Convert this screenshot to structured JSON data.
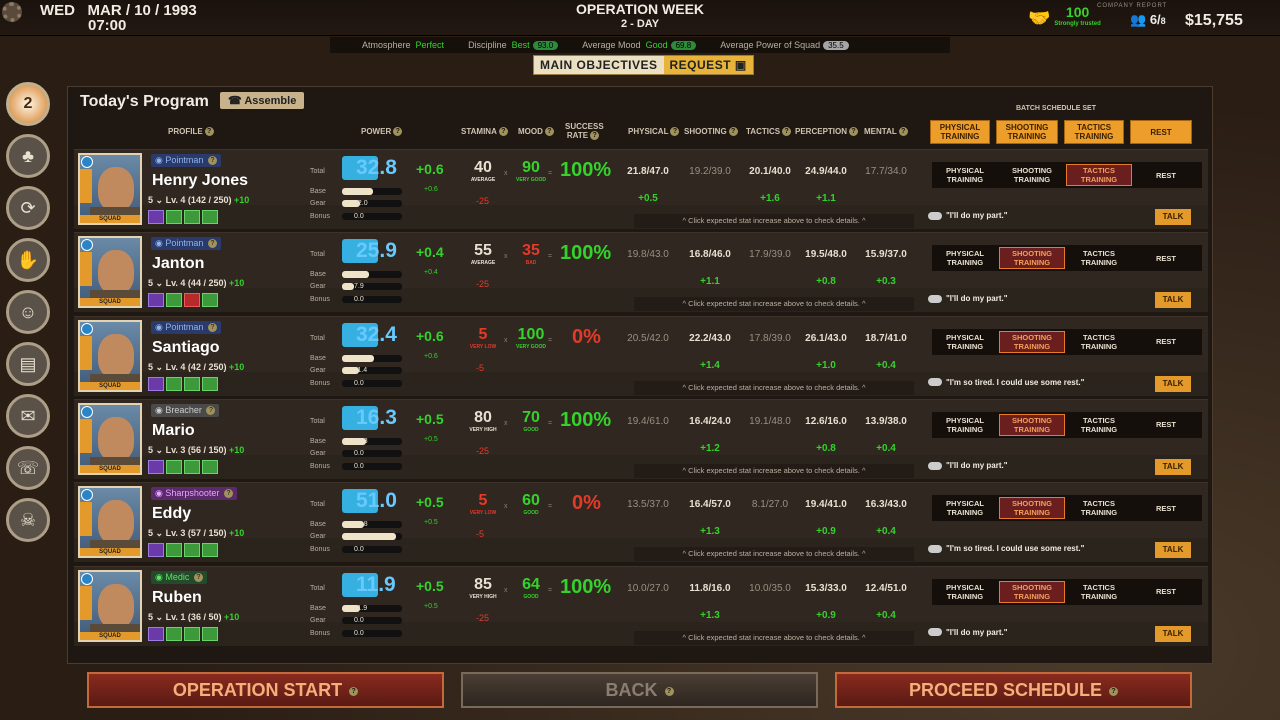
{
  "top": {
    "day": "WED",
    "date": "MAR / 10 / 1993",
    "time": "07:00",
    "op_title": "OPERATION WEEK",
    "op_day": "2 - DAY",
    "trust_value": "100",
    "trust_label": "Strongly trusted",
    "company_report": "COMPANY REPORT",
    "human": "6",
    "human_max": "8",
    "human_label": "HUMAN RESOURCE",
    "money": "$15,755"
  },
  "stats": {
    "atm_label": "Atmosphere",
    "atm_value": "Perfect",
    "disc_label": "Discipline",
    "disc_value": "Best",
    "disc_num": "93.0",
    "mood_label": "Average Mood",
    "mood_value": "Good",
    "mood_num": "69.8",
    "power_label": "Average Power of Squad",
    "power_num": "35.5"
  },
  "tabs": {
    "main": "MAIN OBJECTIVES",
    "request": "REQUEST"
  },
  "side": {
    "badge": "2"
  },
  "panel": {
    "title": "Today's Program",
    "assemble": "Assemble"
  },
  "headers": {
    "profile": "PROFILE",
    "power": "POWER",
    "stamina": "STAMINA",
    "mood": "MOOD",
    "success": "SUCCESS RATE",
    "physical": "PHYSICAL",
    "shooting": "SHOOTING",
    "tactics": "TACTICS",
    "perception": "PERCEPTION",
    "mental": "MENTAL",
    "batch": "BATCH SCHEDULE SET"
  },
  "batch": {
    "phys": "PHYSICAL TRAINING",
    "shoot": "SHOOTING TRAINING",
    "tac": "TACTICS TRAINING",
    "rest": "REST"
  },
  "labels": {
    "total": "Total",
    "base": "Base",
    "gear": "Gear",
    "bonus": "Bonus",
    "squad": "SQUAD",
    "x": "x",
    "eq": "=",
    "hint": "^ Click expected stat increase above to check details. ^",
    "talk": "TALK",
    "tphys": "PHYSICAL TRAINING",
    "tshoot": "SHOOTING TRAINING",
    "ttac": "TACTICS TRAINING",
    "trest": "REST"
  },
  "mercs": [
    {
      "role": "Pointman",
      "name": "Henry Jones",
      "cnt": "5",
      "lvl": "Lv. 4 (142 / 250)",
      "xp": "+10",
      "total": "32.8",
      "inc": "+0.6",
      "base": "20.7",
      "gear": "12.0",
      "bonus": "0.0",
      "binc": "+0.6",
      "stam": "40",
      "stam_lbl": "AVERAGE",
      "stam_minus": "-25",
      "mood": "90",
      "mood_lbl": "VERY GOOD",
      "succ": "100%",
      "phys": "21.8/47.0",
      "shoot": "19.2/39.0",
      "tac": "20.1/40.0",
      "perc": "24.9/44.0",
      "ment": "17.7/34.0",
      "i_phys": "+0.5",
      "i_shoot": "",
      "i_tac": "+1.6",
      "i_perc": "+1.1",
      "i_ment": "",
      "quote": "\"I'll do my part.\"",
      "sel": "tac"
    },
    {
      "role": "Pointman",
      "name": "Janton",
      "cnt": "5",
      "lvl": "Lv. 4 (44 / 250)",
      "xp": "+10",
      "total": "25.9",
      "inc": "+0.4",
      "base": "18.0",
      "gear": "7.9",
      "bonus": "0.0",
      "binc": "+0.4",
      "stam": "55",
      "stam_lbl": "AVERAGE",
      "stam_minus": "-25",
      "mood": "35",
      "mood_lbl": "BAD",
      "succ": "100%",
      "phys": "19.8/43.0",
      "shoot": "16.8/46.0",
      "tac": "17.9/39.0",
      "perc": "19.5/48.0",
      "ment": "15.9/37.0",
      "i_phys": "",
      "i_shoot": "+1.1",
      "i_tac": "",
      "i_perc": "+0.8",
      "i_ment": "+0.3",
      "quote": "\"I'll do my part.\"",
      "sel": "shoot"
    },
    {
      "role": "Pointman",
      "name": "Santiago",
      "cnt": "5",
      "lvl": "Lv. 4 (42 / 250)",
      "xp": "+10",
      "total": "32.4",
      "inc": "+0.6",
      "base": "21.0",
      "gear": "11.4",
      "bonus": "0.0",
      "binc": "+0.6",
      "stam": "5",
      "stam_lbl": "VERY LOW",
      "stam_minus": "-5",
      "mood": "100",
      "mood_lbl": "VERY GOOD",
      "succ": "0%",
      "phys": "20.5/42.0",
      "shoot": "22.2/43.0",
      "tac": "17.8/39.0",
      "perc": "26.1/43.0",
      "ment": "18.7/41.0",
      "i_phys": "",
      "i_shoot": "+1.4",
      "i_tac": "",
      "i_perc": "+1.0",
      "i_ment": "+0.4",
      "quote": "\"I'm so tired. I could use some rest.\"",
      "sel": "shoot"
    },
    {
      "role": "Breacher",
      "name": "Mario",
      "cnt": "5",
      "lvl": "Lv. 3 (56 / 150)",
      "xp": "+10",
      "total": "16.3",
      "inc": "+0.5",
      "base": "16.3",
      "gear": "0.0",
      "bonus": "0.0",
      "binc": "+0.5",
      "stam": "80",
      "stam_lbl": "VERY HIGH",
      "stam_minus": "-25",
      "mood": "70",
      "mood_lbl": "GOOD",
      "succ": "100%",
      "phys": "19.4/61.0",
      "shoot": "16.4/24.0",
      "tac": "19.1/48.0",
      "perc": "12.6/16.0",
      "ment": "13.9/38.0",
      "i_phys": "",
      "i_shoot": "+1.2",
      "i_tac": "",
      "i_perc": "+0.8",
      "i_ment": "+0.4",
      "quote": "\"I'll do my part.\"",
      "sel": "shoot"
    },
    {
      "role": "Sharpshooter",
      "name": "Eddy",
      "cnt": "5",
      "lvl": "Lv. 3 (57 / 150)",
      "xp": "+10",
      "total": "51.0",
      "inc": "+0.5",
      "base": "14.8",
      "gear": "36.2",
      "bonus": "0.0",
      "binc": "+0.5",
      "stam": "5",
      "stam_lbl": "VERY LOW",
      "stam_minus": "-5",
      "mood": "60",
      "mood_lbl": "GOOD",
      "succ": "0%",
      "phys": "13.5/37.0",
      "shoot": "16.4/57.0",
      "tac": "8.1/27.0",
      "perc": "19.4/41.0",
      "ment": "16.3/43.0",
      "i_phys": "",
      "i_shoot": "+1.3",
      "i_tac": "",
      "i_perc": "+0.9",
      "i_ment": "+0.4",
      "quote": "\"I'm so tired. I could use some rest.\"",
      "sel": "shoot"
    },
    {
      "role": "Medic",
      "name": "Ruben",
      "cnt": "5",
      "lvl": "Lv. 1 (36 / 50)",
      "xp": "+10",
      "total": "11.9",
      "inc": "+0.5",
      "base": "11.9",
      "gear": "0.0",
      "bonus": "0.0",
      "binc": "+0.5",
      "stam": "85",
      "stam_lbl": "VERY HIGH",
      "stam_minus": "-25",
      "mood": "64",
      "mood_lbl": "GOOD",
      "succ": "100%",
      "phys": "10.0/27.0",
      "shoot": "11.8/16.0",
      "tac": "10.0/35.0",
      "perc": "15.3/33.0",
      "ment": "12.4/51.0",
      "i_phys": "",
      "i_shoot": "+1.3",
      "i_tac": "",
      "i_perc": "+0.9",
      "i_ment": "+0.4",
      "quote": "\"I'll do my part.\"",
      "sel": "shoot"
    }
  ],
  "bottom": {
    "start": "OPERATION START",
    "back": "BACK",
    "proceed": "PROCEED SCHEDULE"
  }
}
